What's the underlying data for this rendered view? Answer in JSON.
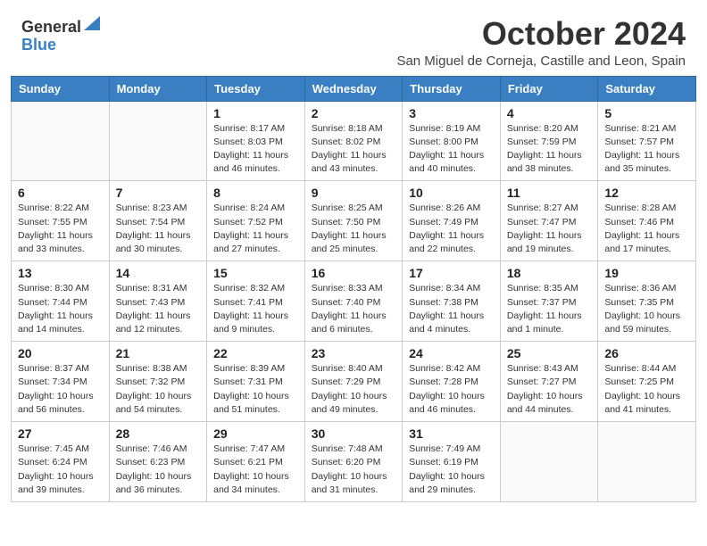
{
  "logo": {
    "general": "General",
    "blue": "Blue"
  },
  "title": "October 2024",
  "location": "San Miguel de Corneja, Castille and Leon, Spain",
  "weekdays": [
    "Sunday",
    "Monday",
    "Tuesday",
    "Wednesday",
    "Thursday",
    "Friday",
    "Saturday"
  ],
  "weeks": [
    [
      {
        "day": "",
        "info": ""
      },
      {
        "day": "",
        "info": ""
      },
      {
        "day": "1",
        "info": "Sunrise: 8:17 AM\nSunset: 8:03 PM\nDaylight: 11 hours and 46 minutes."
      },
      {
        "day": "2",
        "info": "Sunrise: 8:18 AM\nSunset: 8:02 PM\nDaylight: 11 hours and 43 minutes."
      },
      {
        "day": "3",
        "info": "Sunrise: 8:19 AM\nSunset: 8:00 PM\nDaylight: 11 hours and 40 minutes."
      },
      {
        "day": "4",
        "info": "Sunrise: 8:20 AM\nSunset: 7:59 PM\nDaylight: 11 hours and 38 minutes."
      },
      {
        "day": "5",
        "info": "Sunrise: 8:21 AM\nSunset: 7:57 PM\nDaylight: 11 hours and 35 minutes."
      }
    ],
    [
      {
        "day": "6",
        "info": "Sunrise: 8:22 AM\nSunset: 7:55 PM\nDaylight: 11 hours and 33 minutes."
      },
      {
        "day": "7",
        "info": "Sunrise: 8:23 AM\nSunset: 7:54 PM\nDaylight: 11 hours and 30 minutes."
      },
      {
        "day": "8",
        "info": "Sunrise: 8:24 AM\nSunset: 7:52 PM\nDaylight: 11 hours and 27 minutes."
      },
      {
        "day": "9",
        "info": "Sunrise: 8:25 AM\nSunset: 7:50 PM\nDaylight: 11 hours and 25 minutes."
      },
      {
        "day": "10",
        "info": "Sunrise: 8:26 AM\nSunset: 7:49 PM\nDaylight: 11 hours and 22 minutes."
      },
      {
        "day": "11",
        "info": "Sunrise: 8:27 AM\nSunset: 7:47 PM\nDaylight: 11 hours and 19 minutes."
      },
      {
        "day": "12",
        "info": "Sunrise: 8:28 AM\nSunset: 7:46 PM\nDaylight: 11 hours and 17 minutes."
      }
    ],
    [
      {
        "day": "13",
        "info": "Sunrise: 8:30 AM\nSunset: 7:44 PM\nDaylight: 11 hours and 14 minutes."
      },
      {
        "day": "14",
        "info": "Sunrise: 8:31 AM\nSunset: 7:43 PM\nDaylight: 11 hours and 12 minutes."
      },
      {
        "day": "15",
        "info": "Sunrise: 8:32 AM\nSunset: 7:41 PM\nDaylight: 11 hours and 9 minutes."
      },
      {
        "day": "16",
        "info": "Sunrise: 8:33 AM\nSunset: 7:40 PM\nDaylight: 11 hours and 6 minutes."
      },
      {
        "day": "17",
        "info": "Sunrise: 8:34 AM\nSunset: 7:38 PM\nDaylight: 11 hours and 4 minutes."
      },
      {
        "day": "18",
        "info": "Sunrise: 8:35 AM\nSunset: 7:37 PM\nDaylight: 11 hours and 1 minute."
      },
      {
        "day": "19",
        "info": "Sunrise: 8:36 AM\nSunset: 7:35 PM\nDaylight: 10 hours and 59 minutes."
      }
    ],
    [
      {
        "day": "20",
        "info": "Sunrise: 8:37 AM\nSunset: 7:34 PM\nDaylight: 10 hours and 56 minutes."
      },
      {
        "day": "21",
        "info": "Sunrise: 8:38 AM\nSunset: 7:32 PM\nDaylight: 10 hours and 54 minutes."
      },
      {
        "day": "22",
        "info": "Sunrise: 8:39 AM\nSunset: 7:31 PM\nDaylight: 10 hours and 51 minutes."
      },
      {
        "day": "23",
        "info": "Sunrise: 8:40 AM\nSunset: 7:29 PM\nDaylight: 10 hours and 49 minutes."
      },
      {
        "day": "24",
        "info": "Sunrise: 8:42 AM\nSunset: 7:28 PM\nDaylight: 10 hours and 46 minutes."
      },
      {
        "day": "25",
        "info": "Sunrise: 8:43 AM\nSunset: 7:27 PM\nDaylight: 10 hours and 44 minutes."
      },
      {
        "day": "26",
        "info": "Sunrise: 8:44 AM\nSunset: 7:25 PM\nDaylight: 10 hours and 41 minutes."
      }
    ],
    [
      {
        "day": "27",
        "info": "Sunrise: 7:45 AM\nSunset: 6:24 PM\nDaylight: 10 hours and 39 minutes."
      },
      {
        "day": "28",
        "info": "Sunrise: 7:46 AM\nSunset: 6:23 PM\nDaylight: 10 hours and 36 minutes."
      },
      {
        "day": "29",
        "info": "Sunrise: 7:47 AM\nSunset: 6:21 PM\nDaylight: 10 hours and 34 minutes."
      },
      {
        "day": "30",
        "info": "Sunrise: 7:48 AM\nSunset: 6:20 PM\nDaylight: 10 hours and 31 minutes."
      },
      {
        "day": "31",
        "info": "Sunrise: 7:49 AM\nSunset: 6:19 PM\nDaylight: 10 hours and 29 minutes."
      },
      {
        "day": "",
        "info": ""
      },
      {
        "day": "",
        "info": ""
      }
    ]
  ]
}
